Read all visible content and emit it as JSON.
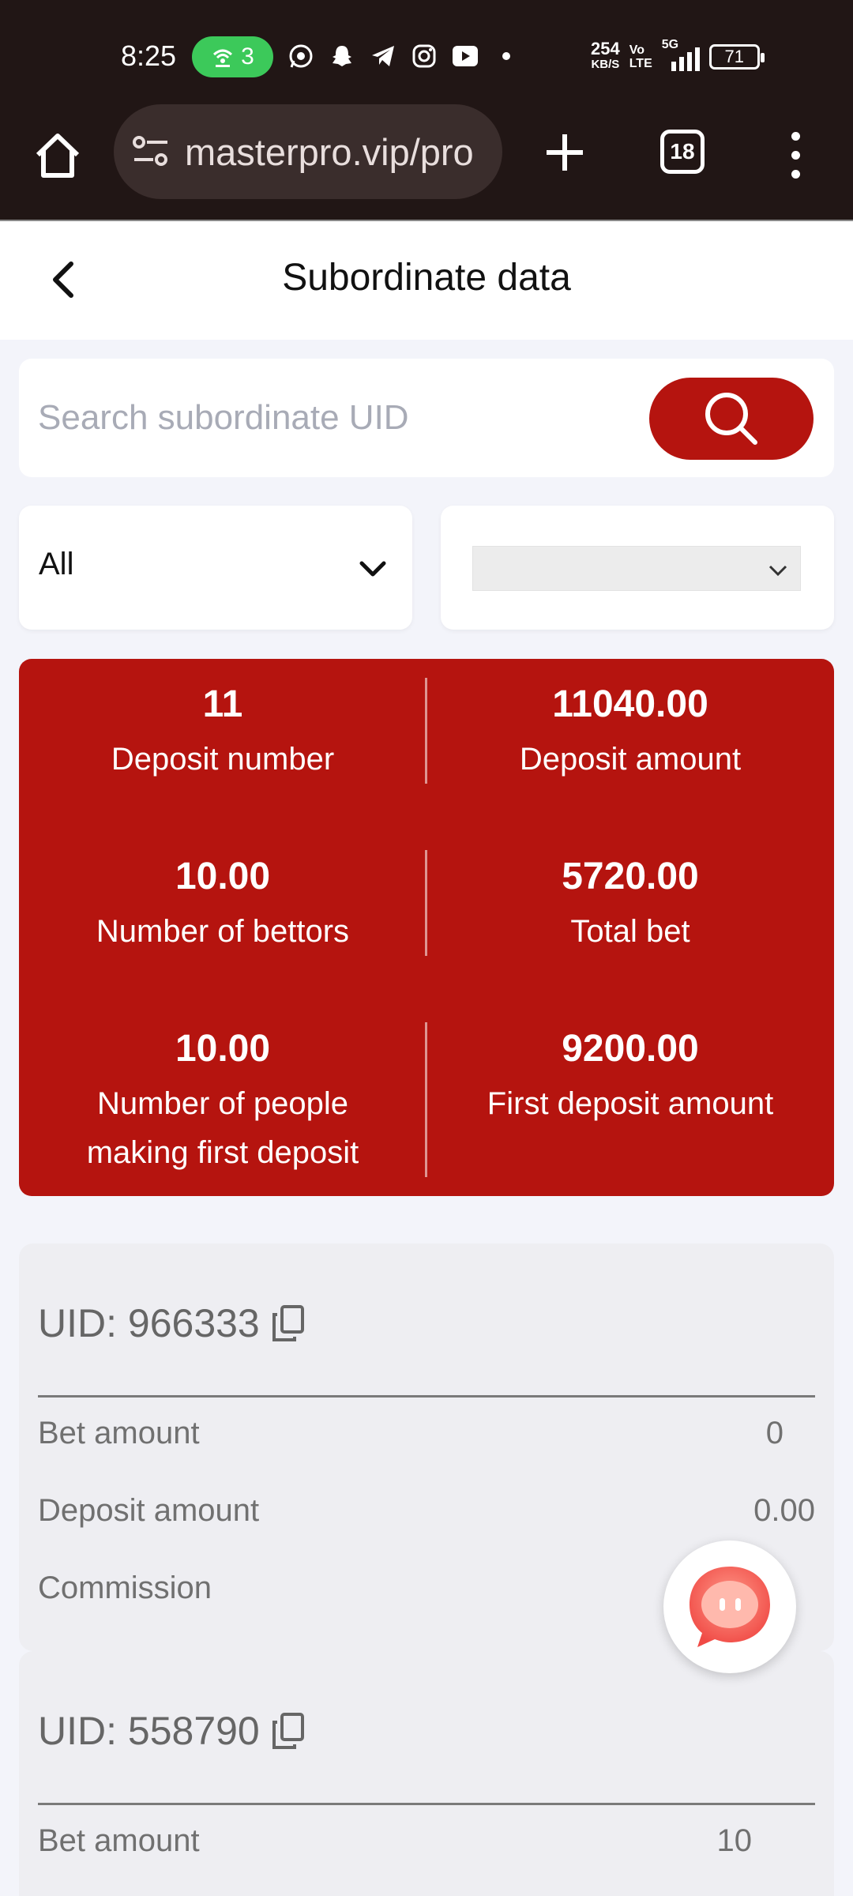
{
  "status_bar": {
    "time": "8:25",
    "hotspot_count": "3",
    "net_speed_value": "254",
    "net_speed_unit": "KB/S",
    "volte_top": "Vo",
    "volte_bottom": "LTE",
    "network": "5G",
    "battery": "71"
  },
  "browser": {
    "url": "masterpro.vip/pro",
    "tab_count": "18"
  },
  "header": {
    "title": "Subordinate data"
  },
  "search": {
    "placeholder": "Search subordinate UID"
  },
  "filters": {
    "level_selected": "All",
    "date_selected": ""
  },
  "stats": {
    "items": [
      {
        "value": "11",
        "label": "Deposit number"
      },
      {
        "value": "11040.00",
        "label": "Deposit amount"
      },
      {
        "value": "10.00",
        "label": "Number of bettors"
      },
      {
        "value": "5720.00",
        "label": "Total bet"
      },
      {
        "value": "10.00",
        "label": "Number of people making first deposit"
      },
      {
        "value": "9200.00",
        "label": "First deposit amount"
      }
    ]
  },
  "subordinates": [
    {
      "uid_text": "UID: 966333",
      "rows": [
        {
          "label": "Bet amount",
          "value": "0"
        },
        {
          "label": "Deposit amount",
          "value": "0.00"
        },
        {
          "label": "Commission",
          "value": ""
        }
      ]
    },
    {
      "uid_text": "UID: 558790",
      "rows": [
        {
          "label": "Bet amount",
          "value": "10"
        }
      ]
    }
  ],
  "colors": {
    "accent": "#b5140f",
    "status_bar": "#211615",
    "page_bg": "#f3f4fa"
  }
}
